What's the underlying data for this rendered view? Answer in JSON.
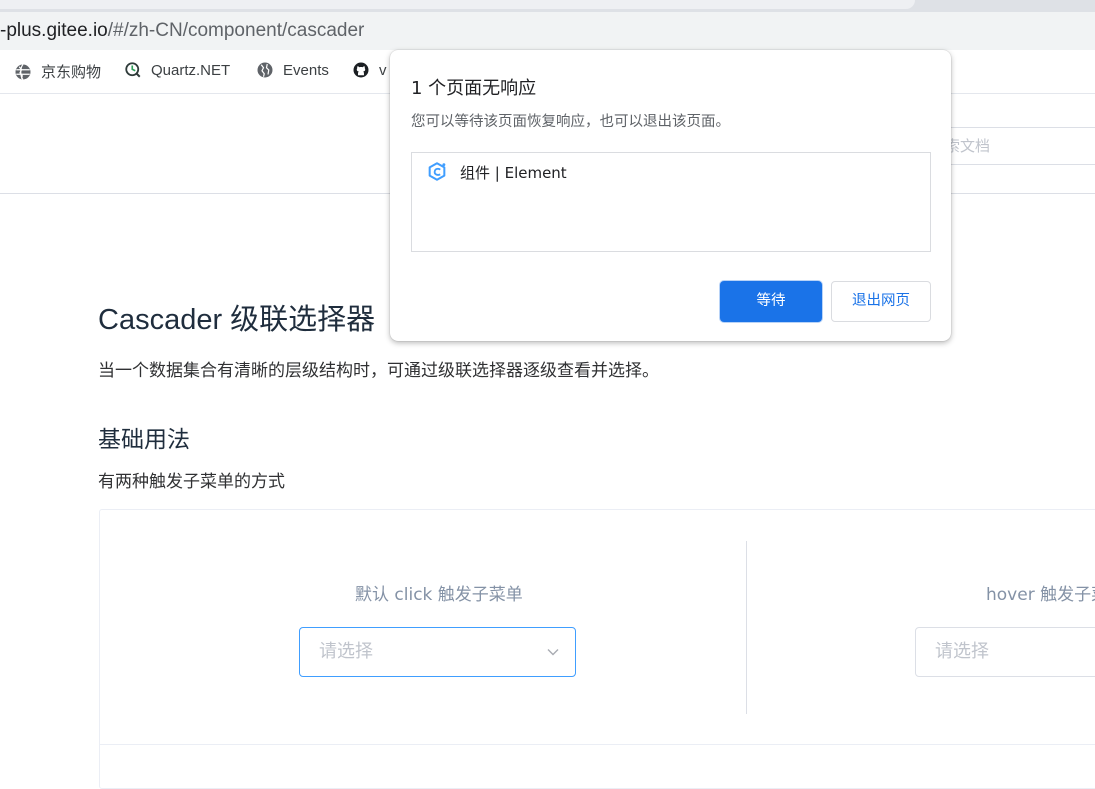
{
  "browser": {
    "address_host": "-plus.gitee.io",
    "address_path": "/#/zh-CN/component/cascader",
    "bookmarks": [
      {
        "icon": "globe-icon",
        "label": "京东购物"
      },
      {
        "icon": "quartz-icon",
        "label": "Quartz.NET"
      },
      {
        "icon": "globe-icon",
        "label": "Events"
      },
      {
        "icon": "github-icon",
        "label": "v"
      }
    ]
  },
  "site_header": {
    "search_placeholder": "索文档"
  },
  "main": {
    "title": "Cascader 级联选择器",
    "description": "当一个数据集合有清晰的层级结构时，可通过级联选择器逐级查看并选择。",
    "section_title": "基础用法",
    "section_description": "有两种触发子菜单的方式",
    "demos": [
      {
        "caption": "默认 click 触发子菜单",
        "placeholder": "请选择"
      },
      {
        "caption": "hover 触发子菜",
        "placeholder": "请选择"
      }
    ]
  },
  "dialog": {
    "title": "1 个页面无响应",
    "body": "您可以等待该页面恢复响应，也可以退出该页面。",
    "page_item": "组件 | Element",
    "wait_label": "等待",
    "exit_label": "退出网页"
  },
  "colors": {
    "primary_button": "#1a73e8",
    "focus_border": "#409eff",
    "caption_text": "#8492a6"
  }
}
